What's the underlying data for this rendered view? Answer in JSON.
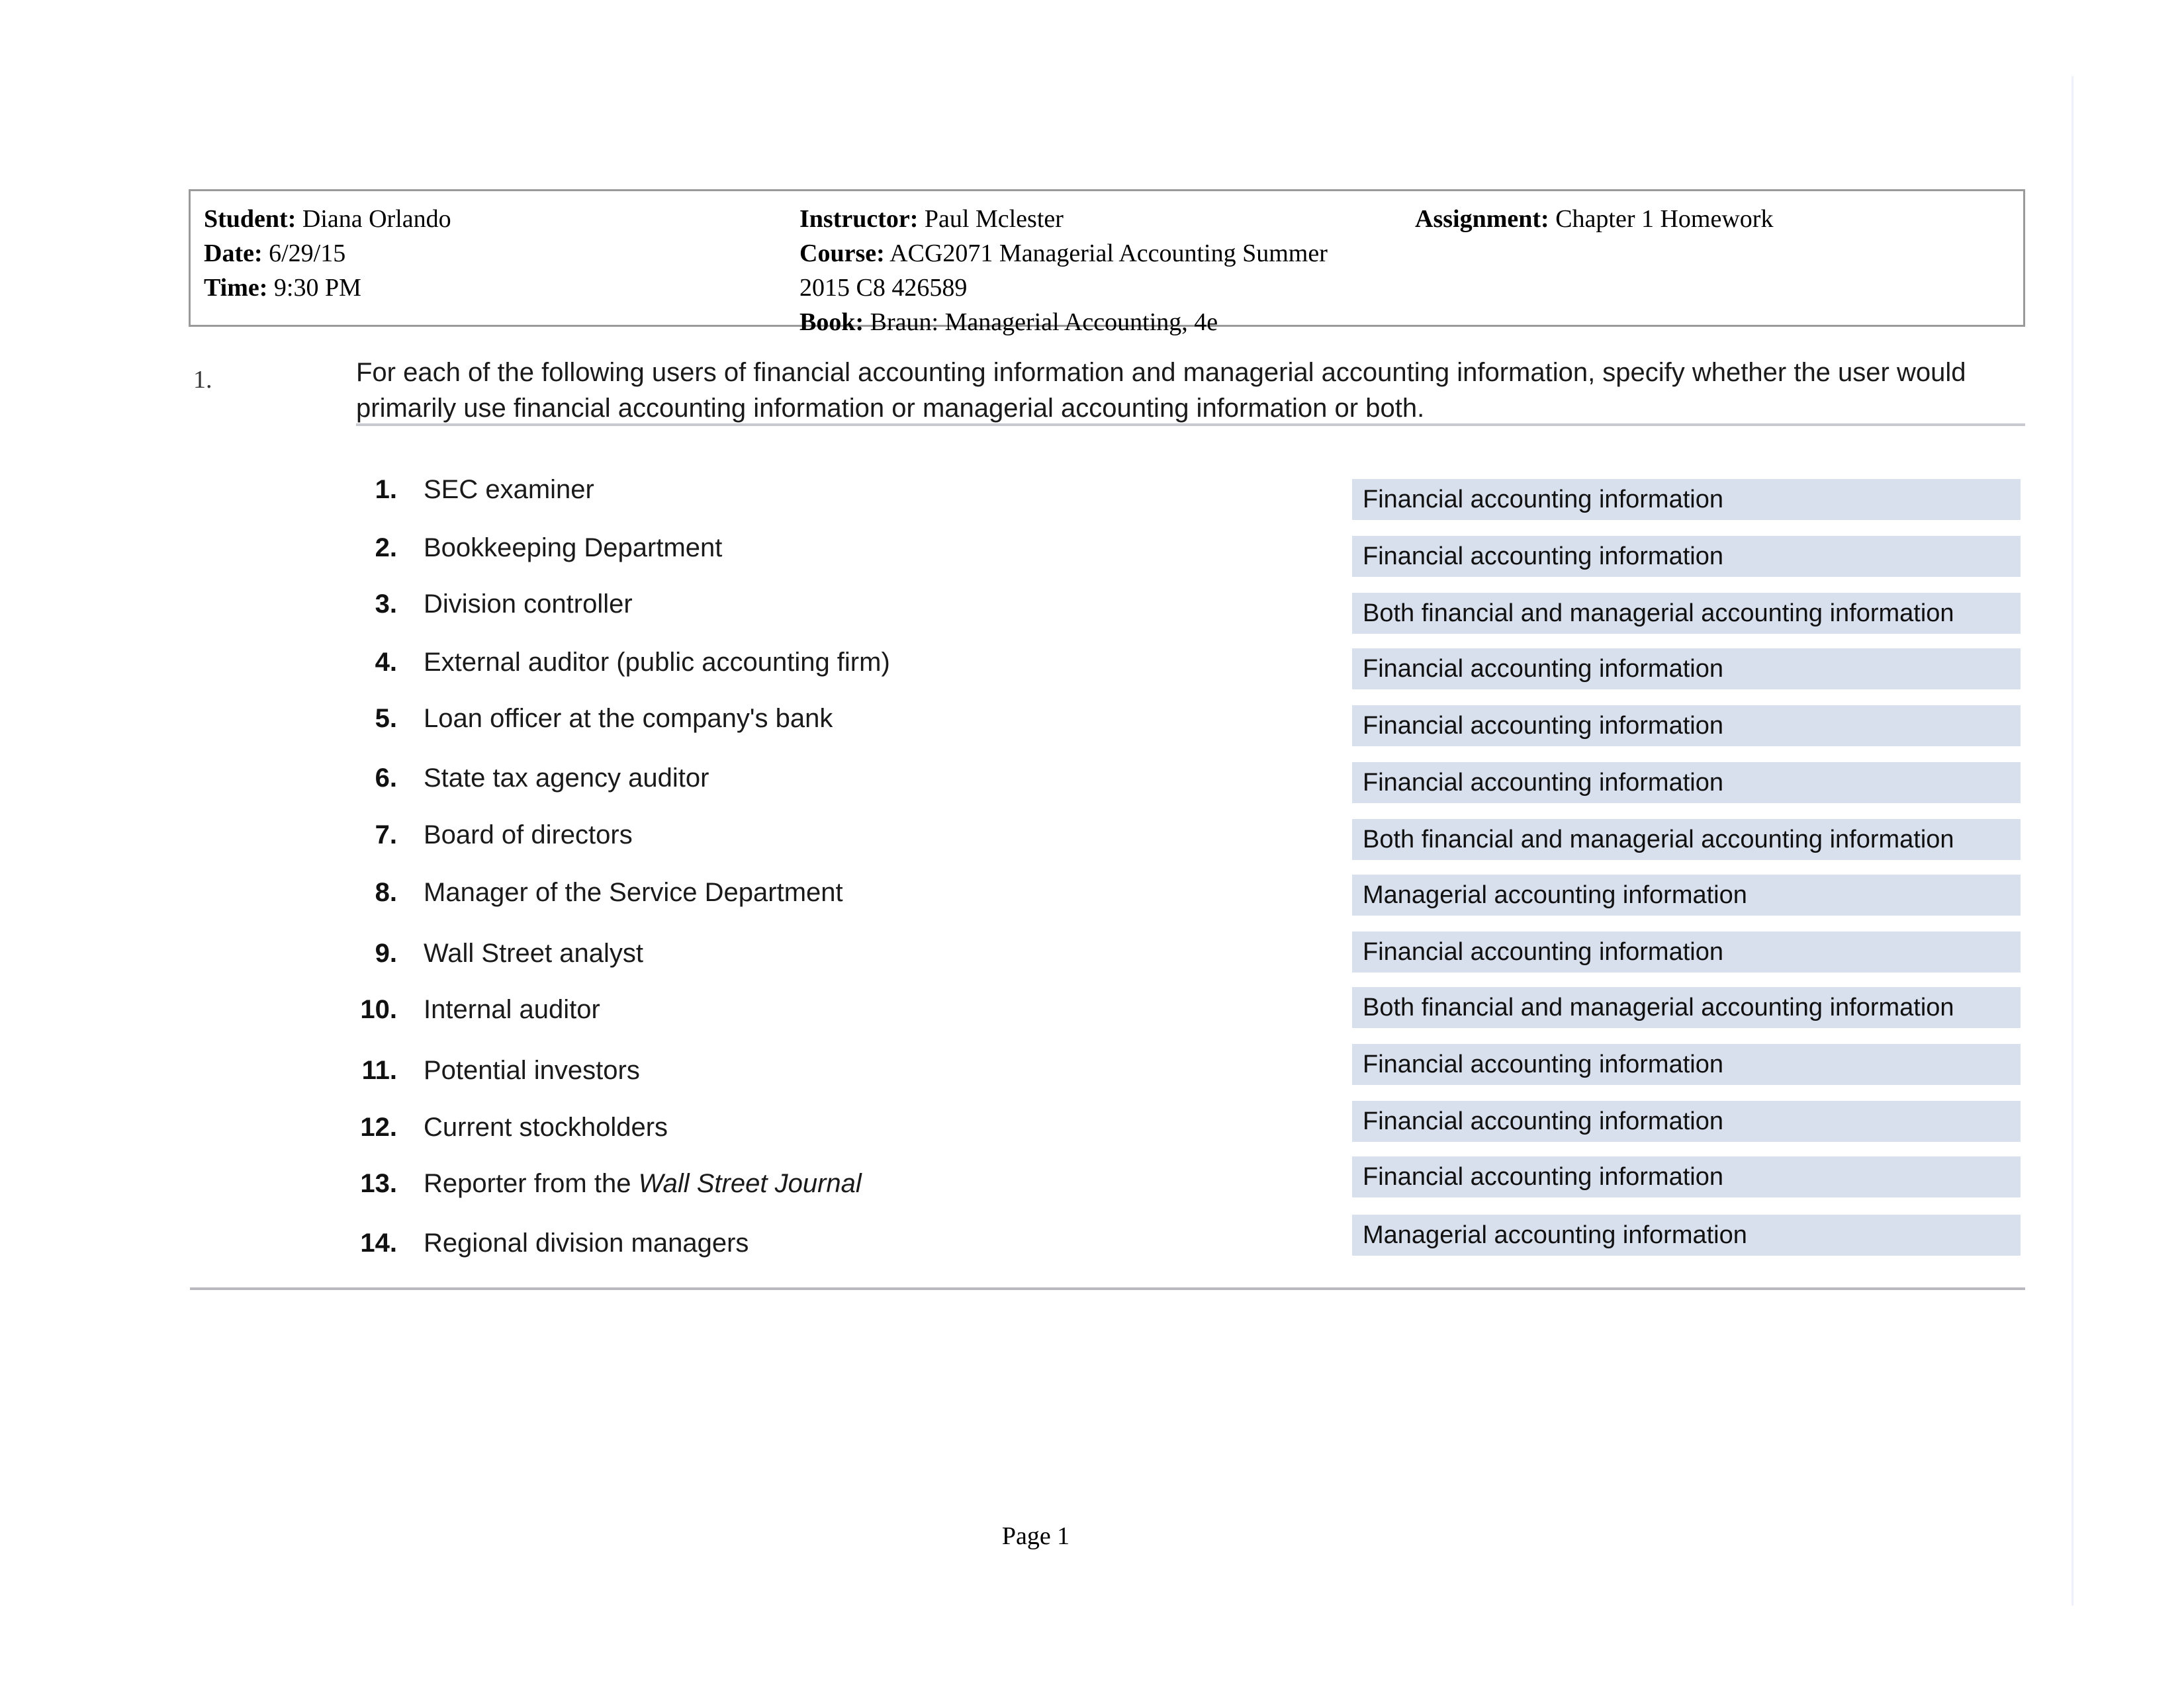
{
  "header": {
    "student_label": "Student:",
    "student_value": "Diana Orlando",
    "date_label": "Date:",
    "date_value": "6/29/15",
    "time_label": "Time:",
    "time_value": "9:30 PM",
    "instructor_label": "Instructor:",
    "instructor_value": "Paul Mclester",
    "course_label": "Course:",
    "course_value": "ACG2071 Managerial Accounting Summer",
    "course_value_line2": "2015 C8 426589",
    "book_label": "Book:",
    "book_value": "Braun: Managerial Accounting, 4e",
    "assignment_label": "Assignment:",
    "assignment_value": "Chapter 1 Homework"
  },
  "question": {
    "number": "1.",
    "text": "For each of the following users of financial accounting information and managerial accounting information, specify whether the user would primarily use financial accounting information or managerial accounting information or both."
  },
  "items": [
    {
      "num": "1.",
      "label": "SEC examiner",
      "answer": "Financial accounting information"
    },
    {
      "num": "2.",
      "label": "Bookkeeping Department",
      "answer": "Financial accounting information"
    },
    {
      "num": "3.",
      "label": "Division controller",
      "answer": "Both financial and managerial accounting information"
    },
    {
      "num": "4.",
      "label": "External auditor (public accounting firm)",
      "answer": "Financial accounting information"
    },
    {
      "num": "5.",
      "label": "Loan officer at the company's bank",
      "answer": "Financial accounting information"
    },
    {
      "num": "6.",
      "label": "State tax agency auditor",
      "answer": "Financial accounting information"
    },
    {
      "num": "7.",
      "label": "Board of directors",
      "answer": "Both financial and managerial accounting information"
    },
    {
      "num": "8.",
      "label": "Manager of the Service Department",
      "answer": "Managerial accounting information"
    },
    {
      "num": "9.",
      "label": "Wall Street analyst",
      "answer": "Financial accounting information"
    },
    {
      "num": "10.",
      "label": "Internal auditor",
      "answer": "Both financial and managerial accounting information"
    },
    {
      "num": "11.",
      "label": "Potential investors",
      "answer": "Financial accounting information"
    },
    {
      "num": "12.",
      "label": "Current stockholders",
      "answer": "Financial accounting information"
    },
    {
      "num": "13.",
      "label": "Reporter from the ",
      "label_italic": "Wall Street Journal",
      "answer": "Financial accounting information"
    },
    {
      "num": "14.",
      "label": "Regional division managers",
      "answer": "Managerial accounting information"
    }
  ],
  "footer": {
    "page_label": "Page 1"
  },
  "colors": {
    "answer_box_fill": "#d8dfed",
    "header_border": "#9a9a9a",
    "rule": "#c9c9d2"
  }
}
